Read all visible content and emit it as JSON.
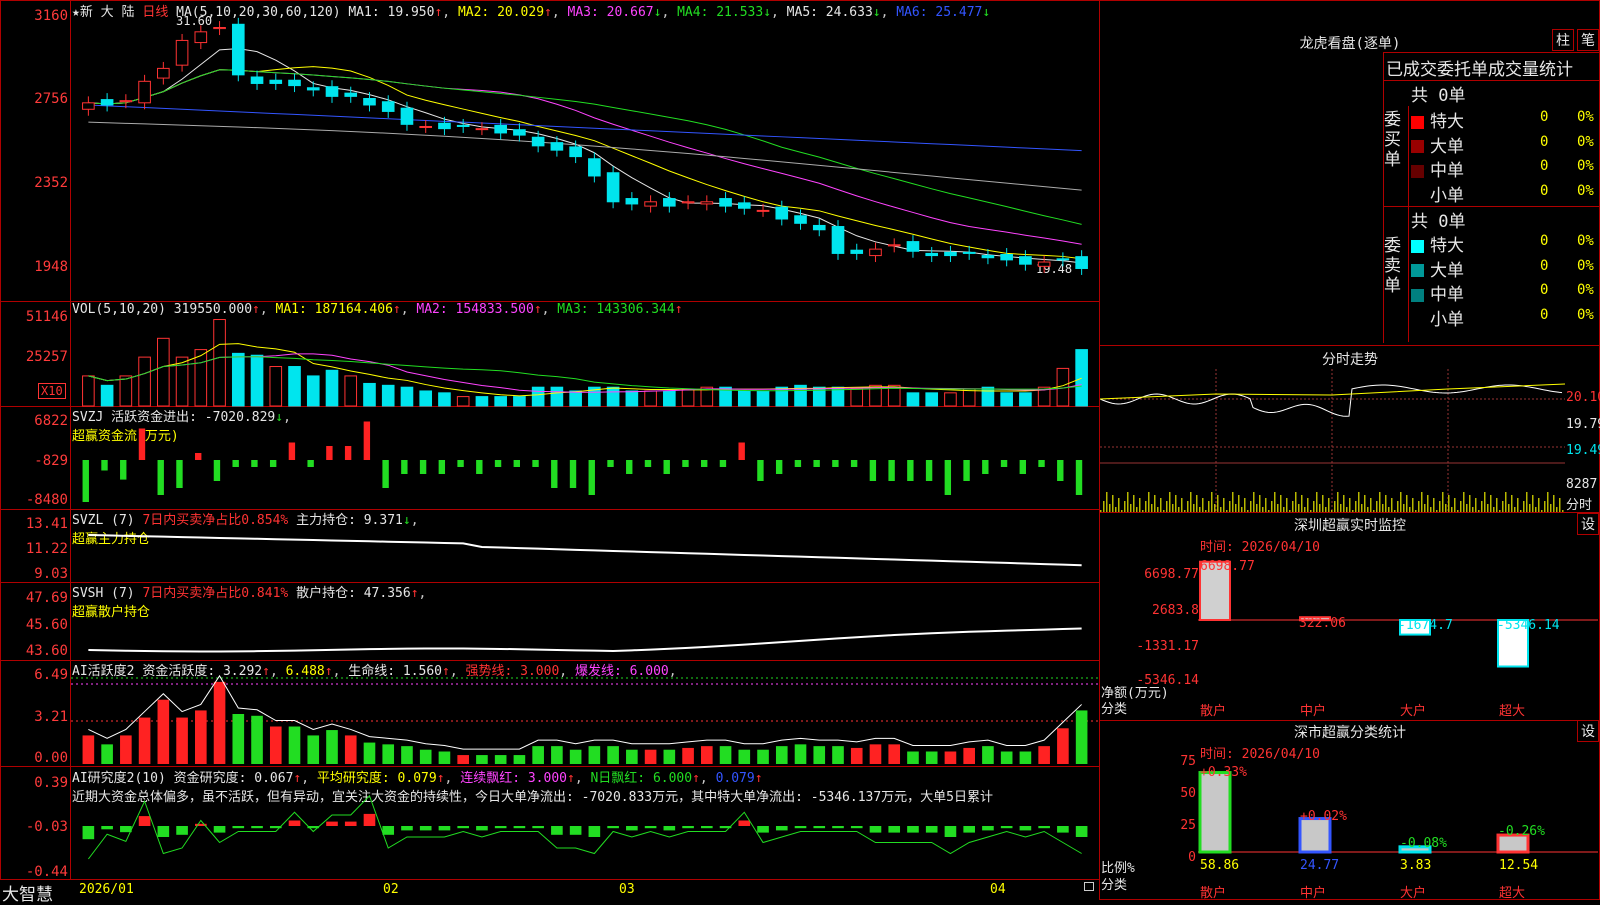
{
  "price_panel": {
    "stock_name": "★新 大 陆",
    "period": "日线",
    "ma_header": "MA(5,10,20,30,60,120)",
    "ma1": "MA1: 19.950",
    "ma2": "MA2: 20.029",
    "ma3": "MA3: 20.667",
    "ma4": "MA4: 21.533",
    "ma5": "MA5: 24.633",
    "ma6": "MA6: 25.477",
    "y_ticks": [
      "3160",
      "2756",
      "2352",
      "1948"
    ],
    "high_label": "31.60",
    "low_label": "19.48"
  },
  "vol_panel": {
    "header": "VOL(5,10,20)",
    "value": "319550.000",
    "ma1": "MA1: 187164.406",
    "ma2": "MA2: 154833.500",
    "ma3": "MA3: 143306.344",
    "y_ticks": [
      "51146",
      "25257"
    ],
    "unit": "X10"
  },
  "svzj_panel": {
    "title": "SVZJ",
    "label": "活跃资金进出: -7020.829",
    "sub": "超赢资金流(万元)",
    "y_ticks": [
      "6822",
      "-829",
      "-8480"
    ]
  },
  "svzl_panel": {
    "title": "SVZL (7)",
    "label": "7日内买卖净占比0.854%",
    "value": "主力持仓: 9.371",
    "sub": "超赢主力持仓",
    "y_ticks": [
      "13.41",
      "11.22",
      "9.03"
    ]
  },
  "svsh_panel": {
    "title": "SVSH (7)",
    "label": "7日内买卖净占比0.841%",
    "value": "散户持仓: 47.356",
    "sub": "超赢散户持仓",
    "y_ticks": [
      "47.69",
      "45.60",
      "43.60"
    ]
  },
  "ai_active": {
    "title": "AI活跃度2",
    "v1": "资金活跃度: 3.292",
    "v2": "6.488",
    "v3": "生命线: 1.560",
    "v4": "强势线: 3.000",
    "v5": "爆发线: 6.000",
    "y_ticks": [
      "6.49",
      "3.21",
      "0.00"
    ]
  },
  "ai_research": {
    "title": "AI研究度2(10)",
    "v1": "资金研究度: 0.067",
    "v2": "平均研究度: 0.079",
    "v3": "连续飘红: 3.000",
    "v4": "N日飘红: 6.000",
    "v5": "0.079",
    "commentary": "近期大资金总体偏多，虽不活跃，但有异动，宜关注大资金的持续性，今日大单净流出: -7020.833万元，其中特大单净流出: -5346.137万元，大单5日累计",
    "y_ticks": [
      "0.39",
      "-0.03",
      "-0.44"
    ]
  },
  "x_axis": {
    "labels": [
      "2026/01",
      "02",
      "03",
      "04"
    ],
    "app_name": "大智慧"
  },
  "dragon_tiger": {
    "title": "龙虎看盘(逐单)",
    "btn1": "柱",
    "btn2": "笔",
    "subtitle": "已成交委托单成交量统计",
    "buy": {
      "total": "共 0单",
      "side": "委买单",
      "rows": [
        {
          "label": "特大",
          "val": "0",
          "pct": "0%",
          "color": "#ff0000"
        },
        {
          "label": "大单",
          "val": "0",
          "pct": "0%",
          "color": "#990000"
        },
        {
          "label": "中单",
          "val": "0",
          "pct": "0%",
          "color": "#660000"
        },
        {
          "label": "小单",
          "val": "0",
          "pct": "0%",
          "color": "#000000"
        }
      ]
    },
    "sell": {
      "total": "共 0单",
      "side": "委卖单",
      "rows": [
        {
          "label": "特大",
          "val": "0",
          "pct": "0%",
          "color": "#00ffff"
        },
        {
          "label": "大单",
          "val": "0",
          "pct": "0%",
          "color": "#009999"
        },
        {
          "label": "中单",
          "val": "0",
          "pct": "0%",
          "color": "#008080"
        },
        {
          "label": "小单",
          "val": "0",
          "pct": "0%",
          "color": "#000000"
        }
      ]
    }
  },
  "intraday": {
    "title": "分时走势",
    "p1": "20.10",
    "p2": "19.79",
    "p3": "19.49",
    "vol": "8287",
    "vol_label": "分时"
  },
  "sz_monitor": {
    "title": "深圳超赢实时监控",
    "btn": "设",
    "time": "时间: 2026/04/10",
    "y_ticks": [
      "6698.77",
      "2683.8",
      "-1331.17",
      "-5346.14"
    ],
    "ylabel": "净额(万元)",
    "xlabel": "分类",
    "categories": [
      "散户",
      "中户",
      "大户",
      "超大"
    ],
    "values": [
      "6698.77",
      "322.06",
      "-1674.7",
      "-5346.14"
    ]
  },
  "sz_classify": {
    "title": "深市超赢分类统计",
    "btn": "设",
    "time": "时间: 2026/04/10",
    "y_ticks": [
      "75",
      "50",
      "25",
      "0"
    ],
    "ylabel": "比例%",
    "xlabel": "分类",
    "categories": [
      "散户",
      "中户",
      "大户",
      "超大"
    ],
    "pct_top": [
      "+0.33%",
      "+0.02%",
      "-0.08%",
      "-0.26%"
    ],
    "pct_bottom": [
      "58.86",
      "24.77",
      "3.83",
      "12.54"
    ]
  },
  "chart_data": {
    "type": "candlestick",
    "closes": [
      27.7,
      27.6,
      27.8,
      28.7,
      29.3,
      30.6,
      31.0,
      31.2,
      29.0,
      28.6,
      28.6,
      28.5,
      28.3,
      28.0,
      28.0,
      27.6,
      27.3,
      26.7,
      26.6,
      26.5,
      26.6,
      26.5,
      26.3,
      26.2,
      25.7,
      25.5,
      25.2,
      24.3,
      23.1,
      23.0,
      23.1,
      22.9,
      23.1,
      23.1,
      22.9,
      22.8,
      22.7,
      22.3,
      22.1,
      21.8,
      20.7,
      20.7,
      20.9,
      21.1,
      20.8,
      20.6,
      20.6,
      20.7,
      20.5,
      20.4,
      20.2,
      20.3,
      20.4,
      20.0
    ],
    "volumes": [
      16,
      11,
      16,
      26,
      36,
      26,
      30,
      46,
      28,
      27,
      21,
      21,
      16,
      19,
      16,
      12,
      11,
      10,
      8,
      7,
      5,
      5,
      5,
      5,
      10,
      10,
      8,
      10,
      10,
      8,
      8,
      8,
      9,
      10,
      10,
      8,
      8,
      10,
      11,
      10,
      10,
      9,
      11,
      11,
      7,
      7,
      7,
      9,
      10,
      7,
      7,
      10,
      20,
      30
    ],
    "fund_flow": [
      -6,
      -1.5,
      -2.8,
      4.5,
      -5,
      -4,
      1,
      -3,
      -1,
      -1,
      -1,
      2.5,
      -1,
      2,
      2,
      5.5,
      -4,
      -2,
      -2,
      -2,
      -1,
      -2,
      -1,
      -1,
      -1,
      -4,
      -4,
      -5,
      -1,
      -2,
      -1,
      -2,
      -1,
      -1,
      -1,
      2.5,
      -3,
      -2,
      -1,
      -1,
      -1,
      -1,
      -3,
      -3,
      -3,
      -3,
      -5,
      -3,
      -2,
      -1,
      -2,
      -1,
      -3,
      -5
    ]
  }
}
